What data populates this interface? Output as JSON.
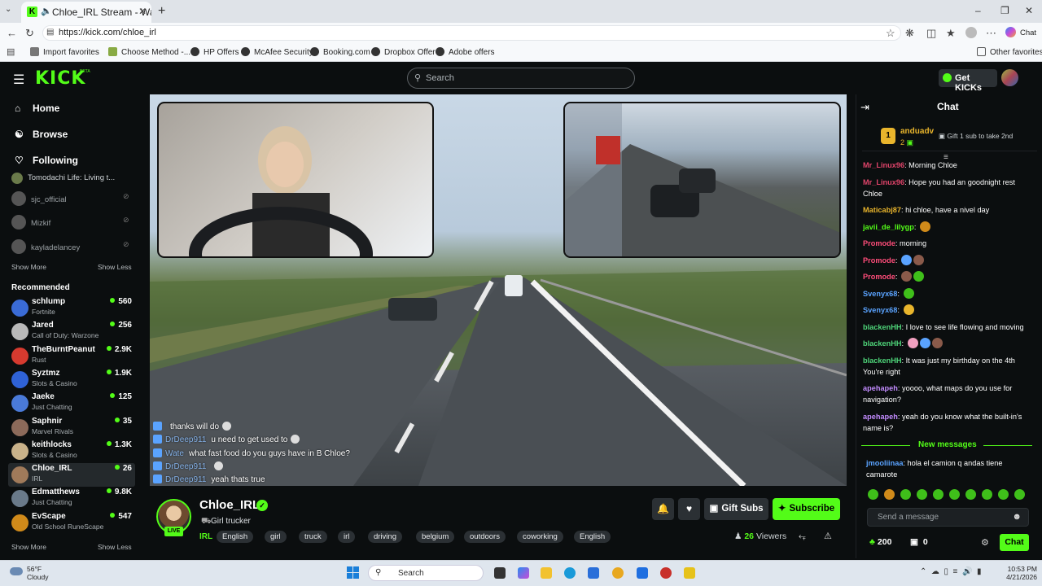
{
  "browser": {
    "tab_title": "Chloe_IRL Stream - Watch Live",
    "url": "https://kick.com/chloe_irl",
    "profile_chat_label": "Chat",
    "bookmarks": [
      "Import favorites",
      "Choose Method -...",
      "HP Offers",
      "McAfee Security",
      "Booking.com",
      "Dropbox Offer",
      "Adobe offers"
    ],
    "other_favorites": "Other favorites"
  },
  "header": {
    "logo": "KICK",
    "beta": "BETA",
    "search_placeholder": "Search",
    "get_kicks": "Get KICKs"
  },
  "sidebar": {
    "nav": [
      {
        "label": "Home",
        "icon": "home-icon"
      },
      {
        "label": "Browse",
        "icon": "compass-icon"
      },
      {
        "label": "Following",
        "icon": "heart-icon"
      }
    ],
    "following": [
      {
        "name": "Tomodachi Life: Living t..."
      },
      {
        "name": "sjc_official"
      },
      {
        "name": "Mizkif"
      },
      {
        "name": "kayladelancey"
      }
    ],
    "show_more": "Show More",
    "show_less": "Show Less",
    "recommended_title": "Recommended",
    "recommended": [
      {
        "name": "schlump",
        "category": "Fortnite",
        "viewers": "560",
        "color": "#3a6bd6"
      },
      {
        "name": "Jared",
        "category": "Call of Duty: Warzone",
        "viewers": "256",
        "color": "#b9b9b9"
      },
      {
        "name": "TheBurntPeanut",
        "category": "Rust",
        "viewers": "2.9K",
        "color": "#d63a2f"
      },
      {
        "name": "Syztmz",
        "category": "Slots & Casino",
        "viewers": "1.9K",
        "color": "#2f62d6"
      },
      {
        "name": "Jaeke",
        "category": "Just Chatting",
        "viewers": "125",
        "color": "#4a7ad8"
      },
      {
        "name": "Saphnir",
        "category": "Marvel Rivals",
        "viewers": "35",
        "color": "#8c6a5a"
      },
      {
        "name": "keithlocks",
        "category": "Slots & Casino",
        "viewers": "1.3K",
        "color": "#c9b28a"
      },
      {
        "name": "Chloe_IRL",
        "category": "IRL",
        "viewers": "26",
        "color": "#a07a5a"
      },
      {
        "name": "Edmatthews",
        "category": "Just Chatting",
        "viewers": "9.8K",
        "color": "#6a7a8a"
      },
      {
        "name": "EvScape",
        "category": "Old School RuneScape",
        "viewers": "547",
        "color": "#d08a1a"
      }
    ]
  },
  "video_chat": [
    {
      "user": "",
      "text": "thanks will do"
    },
    {
      "user": "DrDeep911",
      "text": "u need to get used to"
    },
    {
      "user": "Wate",
      "text": "what fast food do you guys have in B Chloe?"
    },
    {
      "user": "DrDeep911",
      "text": ""
    },
    {
      "user": "DrDeep911",
      "text": "yeah thats true"
    }
  ],
  "stream": {
    "channel": "Chloe_IRL",
    "live": "LIVE",
    "title": "Girl trucker",
    "category": "IRL",
    "tags": [
      "English",
      "girl",
      "truck",
      "irl",
      "driving",
      "belgium",
      "outdoors",
      "coworking",
      "English"
    ],
    "gift_subs": "Gift Subs",
    "subscribe": "Subscribe",
    "viewers": "26",
    "viewers_label": "Viewers"
  },
  "chat": {
    "title": "Chat",
    "pinned_user": "anduadv",
    "pinned_rank": "1",
    "pinned_count": "2",
    "gift_text": "Gift 1 sub to take 2nd",
    "messages": [
      {
        "user": "Mr_Linux96",
        "text": "Morning Chloe",
        "color": "#e0446a"
      },
      {
        "user": "Mr_Linux96",
        "text": "Hope you had an goodnight rest Chloe",
        "color": "#e0446a"
      },
      {
        "user": "Maticabj87",
        "text": "hi chloe, have a nivel day",
        "color": "#e9b52c"
      },
      {
        "user": "javii_de_lilygp",
        "text": "",
        "color": "#53fc18",
        "emotes": 1
      },
      {
        "user": "Promode",
        "text": "morning",
        "color": "#ff4d7a"
      },
      {
        "user": "Promode",
        "text": "",
        "color": "#ff4d7a",
        "emotes": 2
      },
      {
        "user": "Promode",
        "text": "",
        "color": "#ff4d7a",
        "emotes": 2
      },
      {
        "user": "Svenyx68",
        "text": "",
        "color": "#5aa3ff",
        "emotes": 1
      },
      {
        "user": "Svenyx68",
        "text": "",
        "color": "#5aa3ff",
        "emotes": 1
      },
      {
        "user": "blackenHH",
        "text": "I love to see life flowing and moving",
        "color": "#4fd67a"
      },
      {
        "user": "blackenHH",
        "text": "",
        "color": "#4fd67a",
        "emotes": 3
      },
      {
        "user": "blackenHH",
        "text": "It was just my birthday on the 4th You're right",
        "color": "#4fd67a"
      },
      {
        "user": "apehapeh",
        "text": "yoooo, what maps do you use for navigation?",
        "color": "#c38cff"
      },
      {
        "user": "apehapeh",
        "text": "yeah do you know what the built-in's name is?",
        "color": "#c38cff"
      }
    ],
    "new_messages": "New messages",
    "new_message": {
      "user": "jmooliinaa",
      "text": "hola el camion q andas tiene camarote",
      "color": "#5aa3ff"
    },
    "send_placeholder": "Send a message",
    "kicks_balance": "200",
    "gift_balance": "0",
    "chat_button": "Chat"
  },
  "taskbar": {
    "temp": "56°F",
    "weather": "Cloudy",
    "search": "Search",
    "time": "10:53 PM",
    "date": "4/21/2026"
  }
}
